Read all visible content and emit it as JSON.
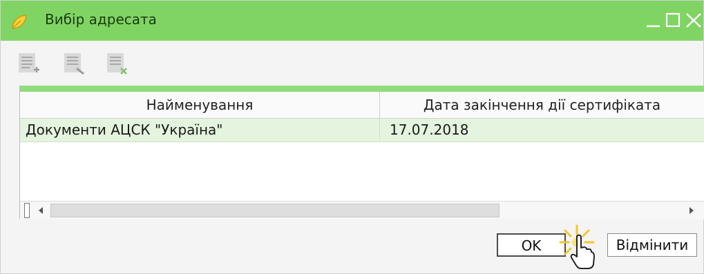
{
  "window": {
    "title": "Вибір адресата",
    "controls": {
      "minimize": "_",
      "maximize": "☐",
      "close": "✕"
    },
    "accent_color": "#80d463"
  },
  "toolbar": {
    "buttons": [
      {
        "name": "add-recipient",
        "icon": "document-add-icon"
      },
      {
        "name": "view-recipient",
        "icon": "document-search-icon"
      },
      {
        "name": "delete-recipient",
        "icon": "document-delete-icon"
      }
    ]
  },
  "grid": {
    "columns": [
      "Найменування",
      "Дата закінчення дії сертифіката"
    ],
    "rows": [
      {
        "name": "Документи АЦСК \"Україна\"",
        "cert_expiry": "17.07.2018"
      }
    ],
    "selected_row_color": "#e4f4df"
  },
  "buttons": {
    "ok": "OK",
    "cancel": "Відмінити"
  }
}
